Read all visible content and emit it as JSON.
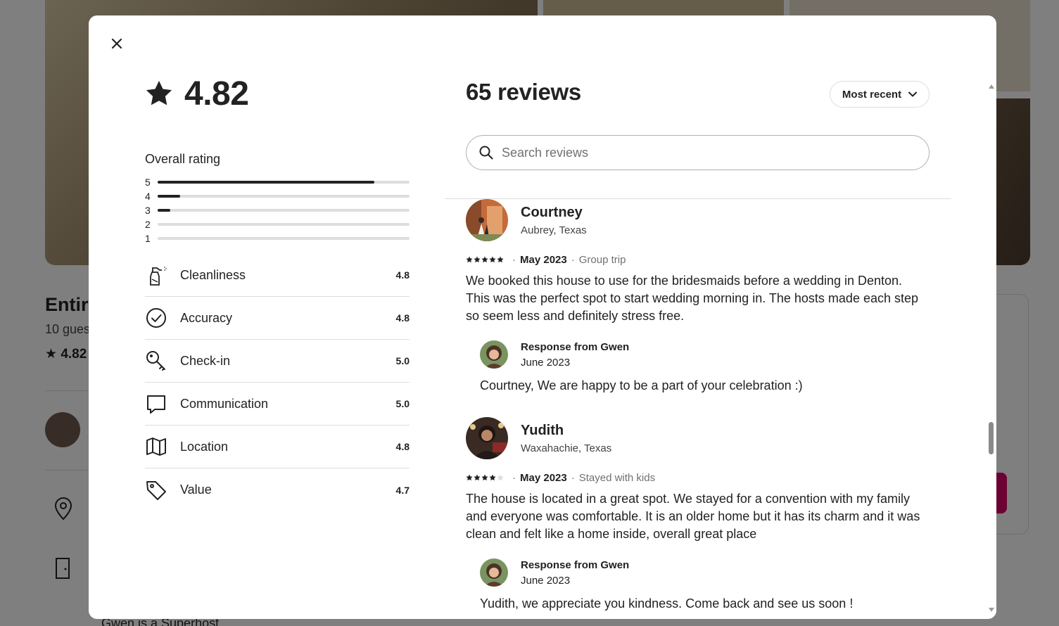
{
  "background": {
    "listing_title": "Entire",
    "listing_sub": "10 gues",
    "listing_rating": "4.82",
    "superhost_text": "Gwen is a Superhost"
  },
  "modal": {
    "overall": {
      "score": "4.82",
      "label": "Overall rating",
      "distribution": [
        {
          "stars": "5",
          "fraction": 0.86
        },
        {
          "stars": "4",
          "fraction": 0.09
        },
        {
          "stars": "3",
          "fraction": 0.05
        },
        {
          "stars": "2",
          "fraction": 0
        },
        {
          "stars": "1",
          "fraction": 0
        }
      ]
    },
    "categories": [
      {
        "name": "Cleanliness",
        "score": "4.8",
        "icon": "spray-bottle-icon"
      },
      {
        "name": "Accuracy",
        "score": "4.8",
        "icon": "check-circle-icon"
      },
      {
        "name": "Check-in",
        "score": "5.0",
        "icon": "key-icon"
      },
      {
        "name": "Communication",
        "score": "5.0",
        "icon": "chat-bubble-icon"
      },
      {
        "name": "Location",
        "score": "4.8",
        "icon": "map-icon"
      },
      {
        "name": "Value",
        "score": "4.7",
        "icon": "tag-icon"
      }
    ],
    "reviews_heading": "65 reviews",
    "sort_label": "Most recent",
    "search_placeholder": "Search reviews",
    "reviews": [
      {
        "name": "Courtney",
        "location": "Aubrey, Texas",
        "stars": 5,
        "date": "May 2023",
        "trip": "Group trip",
        "text": "We booked this house to use for the bridesmaids before a wedding in Denton. This was the perfect spot to start wedding morning in. The hosts made each step so seem less and definitely stress free.",
        "response": {
          "title": "Response from Gwen",
          "date": "June 2023",
          "text": "Courtney, We are happy to be a part of your celebration :)"
        }
      },
      {
        "name": "Yudith",
        "location": "Waxahachie, Texas",
        "stars": 4,
        "date": "May 2023",
        "trip": "Stayed with kids",
        "text": "The house is located in a great spot. We stayed for a convention with my family and everyone was comfortable. It is an older home but it has its charm and it was clean and felt like a home inside, overall great place",
        "response": {
          "title": "Response from Gwen",
          "date": "June 2023",
          "text": "Yudith, we appreciate you kindness. Come back and see us soon !"
        }
      }
    ],
    "colors": {
      "text": "#222222",
      "muted": "#717171",
      "divider": "#dddddd",
      "brand": "#d70466"
    }
  }
}
